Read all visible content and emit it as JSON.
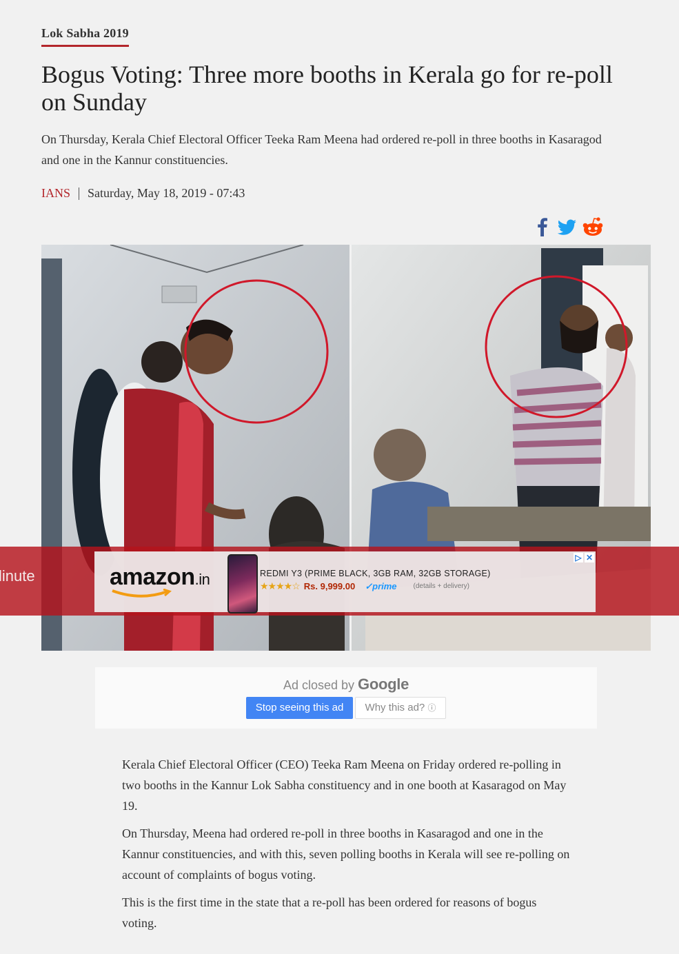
{
  "section": "Lok Sabha 2019",
  "headline": "Bogus Voting: Three more booths in Kerala go for re-poll on Sunday",
  "standfirst": "On Thursday, Kerala Chief Electoral Officer Teeka Ram Meena had ordered re-poll in three booths in Kasaragod and one in the Kannur constituencies.",
  "byline": {
    "author": "IANS",
    "datetime": "Saturday, May 18, 2019 - 07:43"
  },
  "share": [
    {
      "icon": "facebook-icon",
      "color": "#3b5998"
    },
    {
      "icon": "twitter-icon",
      "color": "#1da1f2"
    },
    {
      "icon": "reddit-icon",
      "color": "#ff4500"
    }
  ],
  "ad_strip": {
    "edge_text": "linute",
    "background": "#b4141c",
    "logo": "amazon",
    "logo_tld": ".in",
    "product_title": "REDMI Y3 (PRIME BLACK, 3GB RAM, 32GB STORAGE)",
    "rating_stars": "★★★★☆",
    "price": "Rs. 9,999.00",
    "prime_label": "prime",
    "details": "(details + delivery)",
    "adchoices_icon": "adchoices-icon",
    "close_icon": "close-icon"
  },
  "ad_closed": {
    "prefix": "Ad closed by",
    "brand": "Google",
    "stop_button": "Stop seeing this ad",
    "why_button": "Why this ad?",
    "info_icon": "info-icon"
  },
  "body_paragraphs": [
    "Kerala Chief Electoral Officer (CEO) Teeka Ram Meena on Friday ordered re-polling in two booths in the Kannur Lok Sabha constituency and in one booth at Kasaragod on May 19.",
    "On Thursday, Meena had ordered re-poll in three booths in Kasaragod and one in the Kannur constituencies, and with this, seven polling booths in Kerala will see re-polling on account of complaints of bogus voting.",
    "This is the first time in the state that a re-poll has been ordered for reasons of bogus voting."
  ]
}
